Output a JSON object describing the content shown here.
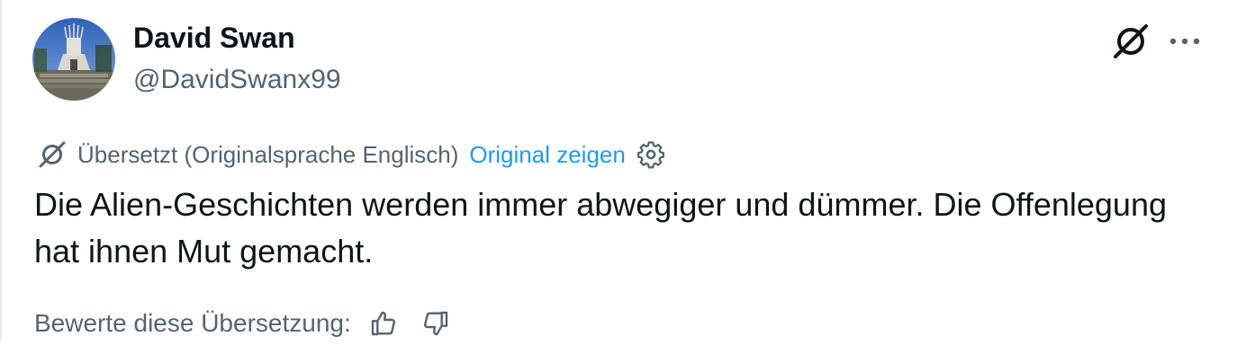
{
  "author": {
    "display_name": "David Swan",
    "handle": "@DavidSwanx99",
    "avatar_icon": "avatar-photo"
  },
  "header_actions": {
    "grok_icon": "grok-icon",
    "more_icon": "more-dots-icon"
  },
  "translation": {
    "icon": "translate-icon",
    "label": "Übersetzt (Originalsprache Englisch)",
    "show_original": "Original zeigen",
    "settings_icon": "gear-icon"
  },
  "tweet": {
    "text": "Die Alien-Geschichten werden immer abwegiger und dümmer. Die Offenlegung hat ihnen Mut gemacht."
  },
  "rating": {
    "label": "Bewerte diese Übersetzung:",
    "thumbs_up_icon": "thumbs-up-icon",
    "thumbs_down_icon": "thumbs-down-icon"
  },
  "colors": {
    "text_primary": "#0f1419",
    "text_secondary": "#536471",
    "link": "#1d9bf0"
  }
}
